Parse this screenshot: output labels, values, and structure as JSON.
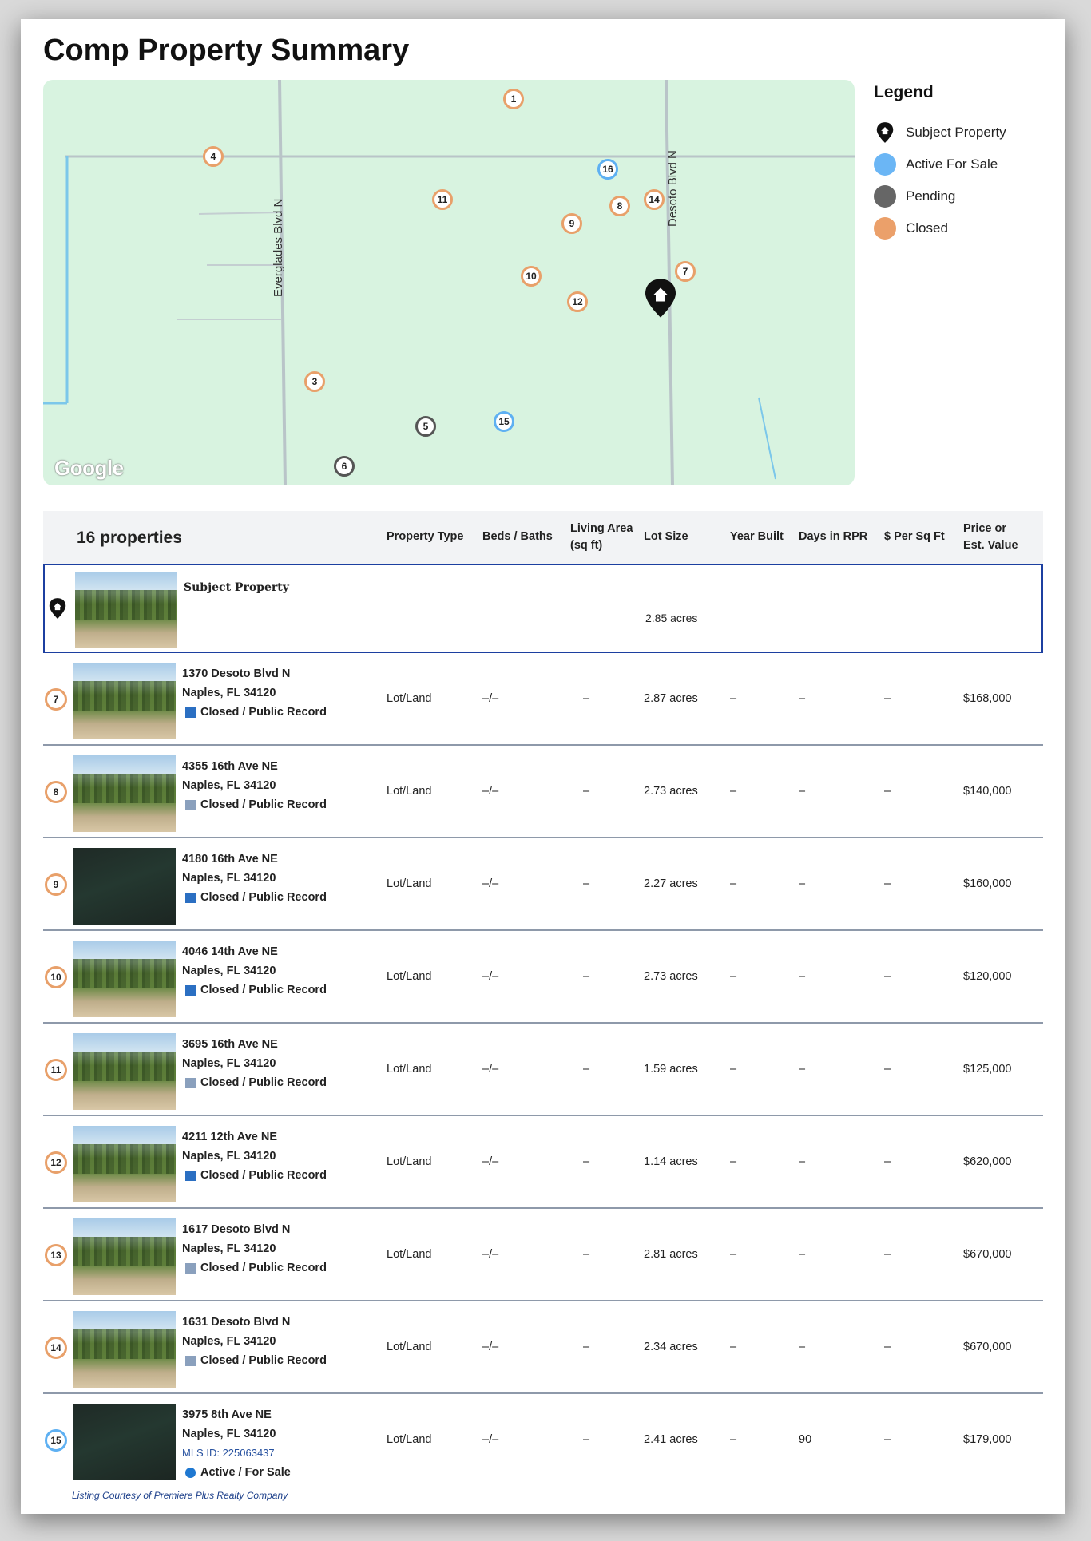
{
  "page": {
    "title": "Comp Property Summary"
  },
  "map": {
    "roads": [
      "Everglades Blvd N",
      "Desoto Blvd N"
    ],
    "logo": "Google",
    "pins": [
      {
        "label": "1",
        "status": "closed"
      },
      {
        "label": "4",
        "status": "closed"
      },
      {
        "label": "16",
        "status": "active"
      },
      {
        "label": "11",
        "status": "closed"
      },
      {
        "label": "8",
        "status": "closed"
      },
      {
        "label": "14",
        "status": "closed"
      },
      {
        "label": "9",
        "status": "closed"
      },
      {
        "label": "10",
        "status": "closed"
      },
      {
        "label": "7",
        "status": "closed"
      },
      {
        "label": "12",
        "status": "closed"
      },
      {
        "label": "3",
        "status": "closed"
      },
      {
        "label": "5",
        "status": "pending"
      },
      {
        "label": "15",
        "status": "active"
      },
      {
        "label": "6",
        "status": "pending"
      }
    ]
  },
  "legend": {
    "title": "Legend",
    "items": [
      {
        "label": "Subject Property",
        "icon": "home-pin-icon"
      },
      {
        "label": "Active For Sale",
        "color": "#6bb6f5"
      },
      {
        "label": "Pending",
        "color": "#666666"
      },
      {
        "label": "Closed",
        "color": "#eba06a"
      }
    ]
  },
  "table": {
    "count": "16 properties",
    "headers": {
      "type": "Property Type",
      "beds": "Beds / Baths",
      "living_1": "Living Area",
      "living_2": "(sq ft)",
      "lot": "Lot Size",
      "year": "Year Built",
      "days": "Days in RPR",
      "ppsf": "$ Per Sq Ft",
      "price_1": "Price or",
      "price_2": "Est. Value"
    },
    "subject": {
      "label": "Subject Property",
      "lot": "2.85 acres"
    },
    "rows": [
      {
        "num": "7",
        "street": "1370 Desoto Blvd N",
        "city": "Naples, FL 34120",
        "status": "Closed / Public Record",
        "type": "Lot/Land",
        "beds": "–/–",
        "living": "–",
        "lot": "2.87 acres",
        "year": "–",
        "days": "–",
        "ppsf": "–",
        "price": "$168,000"
      },
      {
        "num": "8",
        "street": "4355 16th Ave NE",
        "city": "Naples, FL 34120",
        "status": "Closed / Public Record",
        "type": "Lot/Land",
        "beds": "–/–",
        "living": "–",
        "lot": "2.73 acres",
        "year": "–",
        "days": "–",
        "ppsf": "–",
        "price": "$140,000"
      },
      {
        "num": "9",
        "street": "4180 16th Ave NE",
        "city": "Naples, FL 34120",
        "status": "Closed / Public Record",
        "type": "Lot/Land",
        "beds": "–/–",
        "living": "–",
        "lot": "2.27 acres",
        "year": "–",
        "days": "–",
        "ppsf": "–",
        "price": "$160,000"
      },
      {
        "num": "10",
        "street": "4046 14th Ave NE",
        "city": "Naples, FL 34120",
        "status": "Closed / Public Record",
        "type": "Lot/Land",
        "beds": "–/–",
        "living": "–",
        "lot": "2.73 acres",
        "year": "–",
        "days": "–",
        "ppsf": "–",
        "price": "$120,000"
      },
      {
        "num": "11",
        "street": "3695 16th Ave NE",
        "city": "Naples, FL 34120",
        "status": "Closed / Public Record",
        "type": "Lot/Land",
        "beds": "–/–",
        "living": "–",
        "lot": "1.59 acres",
        "year": "–",
        "days": "–",
        "ppsf": "–",
        "price": "$125,000"
      },
      {
        "num": "12",
        "street": "4211 12th Ave NE",
        "city": "Naples, FL 34120",
        "status": "Closed / Public Record",
        "type": "Lot/Land",
        "beds": "–/–",
        "living": "–",
        "lot": "1.14 acres",
        "year": "–",
        "days": "–",
        "ppsf": "–",
        "price": "$620,000"
      },
      {
        "num": "13",
        "street": "1617 Desoto Blvd N",
        "city": "Naples, FL 34120",
        "status": "Closed / Public Record",
        "type": "Lot/Land",
        "beds": "–/–",
        "living": "–",
        "lot": "2.81 acres",
        "year": "–",
        "days": "–",
        "ppsf": "–",
        "price": "$670,000"
      },
      {
        "num": "14",
        "street": "1631 Desoto Blvd N",
        "city": "Naples, FL 34120",
        "status": "Closed / Public Record",
        "type": "Lot/Land",
        "beds": "–/–",
        "living": "–",
        "lot": "2.34 acres",
        "year": "–",
        "days": "–",
        "ppsf": "–",
        "price": "$670,000"
      },
      {
        "num": "15",
        "street": "3975 8th Ave NE",
        "city": "Naples, FL 34120",
        "mls": "MLS ID: 225063437",
        "status": "Active / For Sale",
        "type": "Lot/Land",
        "beds": "–/–",
        "living": "–",
        "lot": "2.41 acres",
        "year": "–",
        "days": "90",
        "ppsf": "–",
        "price": "$179,000",
        "courtesy": "Listing Courtesy of Premiere Plus Realty Company"
      }
    ]
  },
  "colors": {
    "closed": "#e8a06a",
    "active": "#5eb0f2",
    "pending": "#555555",
    "subject_border": "#1c3fa0"
  }
}
